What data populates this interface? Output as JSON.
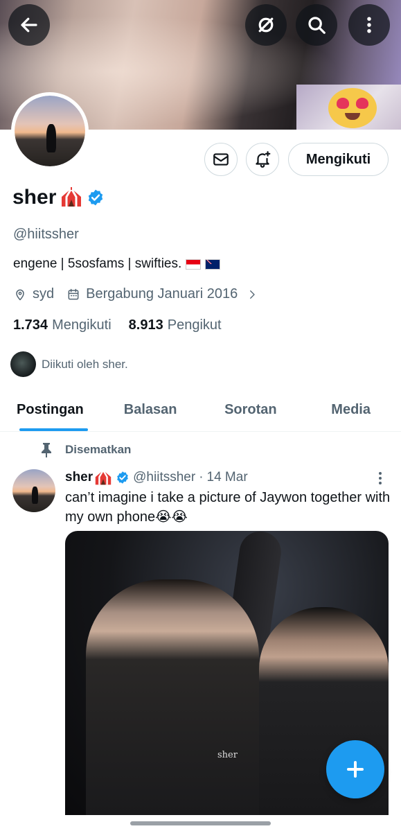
{
  "profile": {
    "name": "sher",
    "handle": "@hiitssher",
    "bio": "engene | 5sosfams | swifties.",
    "location": "syd",
    "joined": "Bergabung Januari 2016",
    "following_count": "1.734",
    "following_label": "Mengikuti",
    "followers_count": "8.913",
    "followers_label": "Pengikut",
    "followed_by": "Diikuti oleh sher.",
    "follow_button": "Mengikuti"
  },
  "tabs": [
    {
      "label": "Postingan",
      "active": true
    },
    {
      "label": "Balasan",
      "active": false
    },
    {
      "label": "Sorotan",
      "active": false
    },
    {
      "label": "Media",
      "active": false
    }
  ],
  "pinned_tweet": {
    "pinned_label": "Disematkan",
    "name": "sher",
    "handle": "@hiitssher",
    "separator": "·",
    "date": "14 Mar",
    "text": "can’t imagine i take a picture of Jaywon together with my own phone😭😭",
    "media_watermark": "sher"
  },
  "icons": {
    "back": "arrow-left-icon",
    "grok": "grok-icon",
    "search": "search-icon",
    "more": "more-vertical-icon",
    "message": "envelope-icon",
    "notify": "bell-plus-icon",
    "location": "location-pin-icon",
    "calendar": "calendar-icon",
    "verified": "verified-badge-icon",
    "pin": "pin-icon",
    "compose": "plus-icon"
  },
  "colors": {
    "accent": "#1d9bf0",
    "text_primary": "#0f1419",
    "text_secondary": "#536471"
  }
}
